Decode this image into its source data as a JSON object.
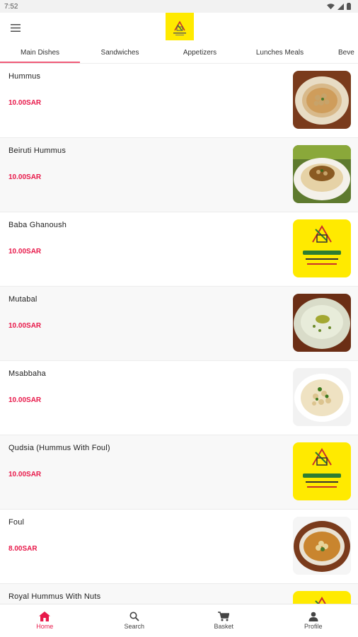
{
  "status_bar": {
    "time": "7:52"
  },
  "header": {
    "menu_icon": "menu-icon",
    "logo_icon": "restaurant-logo"
  },
  "tabs": [
    {
      "label": "Main Dishes",
      "active": true
    },
    {
      "label": "Sandwiches",
      "active": false
    },
    {
      "label": "Appetizers",
      "active": false
    },
    {
      "label": "Lunches Meals",
      "active": false
    },
    {
      "label": "Beve",
      "active": false
    }
  ],
  "items": [
    {
      "name": "Hummus",
      "price": "10.00SAR",
      "image": "hummus-photo"
    },
    {
      "name": "Beiruti Hummus",
      "price": "10.00SAR",
      "image": "beiruti-hummus-photo"
    },
    {
      "name": "Baba Ghanoush",
      "price": "10.00SAR",
      "image": "restaurant-logo"
    },
    {
      "name": "Mutabal",
      "price": "10.00SAR",
      "image": "mutabal-photo"
    },
    {
      "name": "Msabbaha",
      "price": "10.00SAR",
      "image": "msabbaha-photo"
    },
    {
      "name": "Qudsia (Hummus With Foul)",
      "price": "10.00SAR",
      "image": "restaurant-logo"
    },
    {
      "name": "Foul",
      "price": "8.00SAR",
      "image": "foul-photo"
    },
    {
      "name": "Royal Hummus With Nuts",
      "price": "",
      "image": "restaurant-logo"
    }
  ],
  "bottom_nav": [
    {
      "label": "Home",
      "icon": "home-icon",
      "active": true
    },
    {
      "label": "Search",
      "icon": "search-icon",
      "active": false
    },
    {
      "label": "Basket",
      "icon": "cart-icon",
      "active": false
    },
    {
      "label": "Profile",
      "icon": "profile-icon",
      "active": false
    }
  ],
  "colors": {
    "accent": "#e8194a",
    "tab_indicator": "#f05a78",
    "logo_yellow": "#ffea00"
  }
}
